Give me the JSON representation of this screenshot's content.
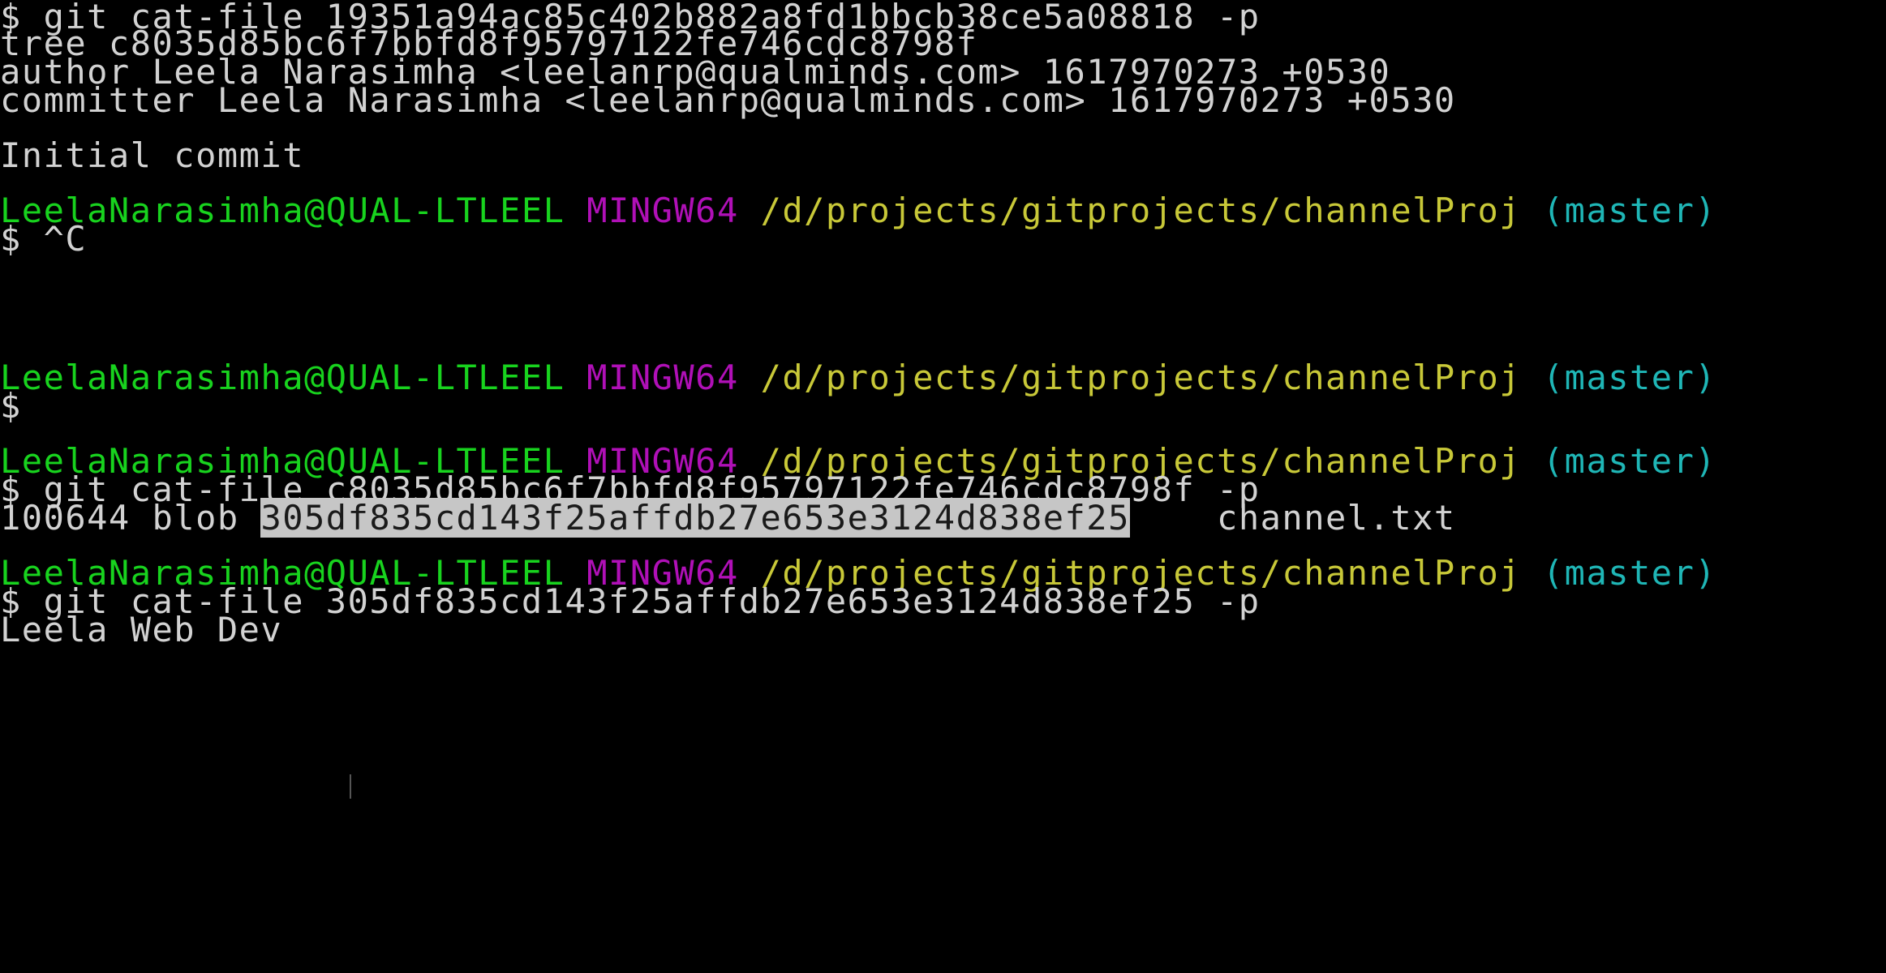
{
  "colors": {
    "background": "#000000",
    "text": "#d2d2d2",
    "user_host": "#18d31e",
    "system": "#b010b7",
    "path": "#c8c838",
    "branch": "#1fb6b6",
    "selection_bg": "#c6c6c6"
  },
  "prompt": {
    "user_host": "LeelaNarasimha@QUAL-LTLEEL",
    "system": "MINGW64",
    "path": "/d/projects/gitprojects/channelProj",
    "branch": "(master)"
  },
  "lines": {
    "cmd1": "$ git cat-file 19351a94ac85c402b882a8fd1bbcb38ce5a08818 -p",
    "out1_tree": "tree c8035d85bc6f7bbfd8f95797122fe746cdc8798f",
    "out1_author": "author Leela Narasimha <leelanrp@qualminds.com> 1617970273 +0530",
    "out1_committer": "committer Leela Narasimha <leelanrp@qualminds.com> 1617970273 +0530",
    "out1_message": "Initial commit",
    "cmd2": "$ ^C",
    "cmd3": "$",
    "cmd4": "$ git cat-file c8035d85bc6f7bbfd8f95797122fe746cdc8798f -p",
    "out4_prefix": "100644 blob ",
    "out4_hash": "305df835cd143f25affdb27e653e3124d838ef25",
    "out4_name": "channel.txt",
    "cmd5": "$ git cat-file 305df835cd143f25affdb27e653e3124d838ef25 -p",
    "out5": "Leela Web Dev"
  }
}
